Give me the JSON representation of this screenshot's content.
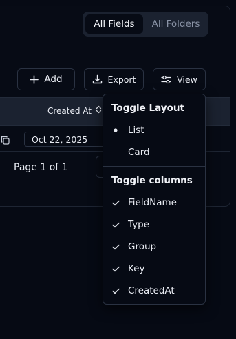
{
  "view_switch": {
    "all_fields": "All Fields",
    "all_folders": "All Folders"
  },
  "toolbar": {
    "add_label": "Add",
    "export_label": "Export",
    "view_label": "View"
  },
  "table": {
    "header_created_at": "Created At",
    "row_created_at": "Oct 22, 2025"
  },
  "pagination": {
    "label": "Page 1 of 1"
  },
  "view_menu": {
    "layout_heading": "Toggle Layout",
    "layout_options": [
      {
        "label": "List",
        "selected": true
      },
      {
        "label": "Card",
        "selected": false
      }
    ],
    "columns_heading": "Toggle columns",
    "columns": [
      {
        "label": "FieldName",
        "checked": true
      },
      {
        "label": "Type",
        "checked": true
      },
      {
        "label": "Group",
        "checked": true
      },
      {
        "label": "Key",
        "checked": true
      },
      {
        "label": "CreatedAt",
        "checked": true
      }
    ]
  }
}
